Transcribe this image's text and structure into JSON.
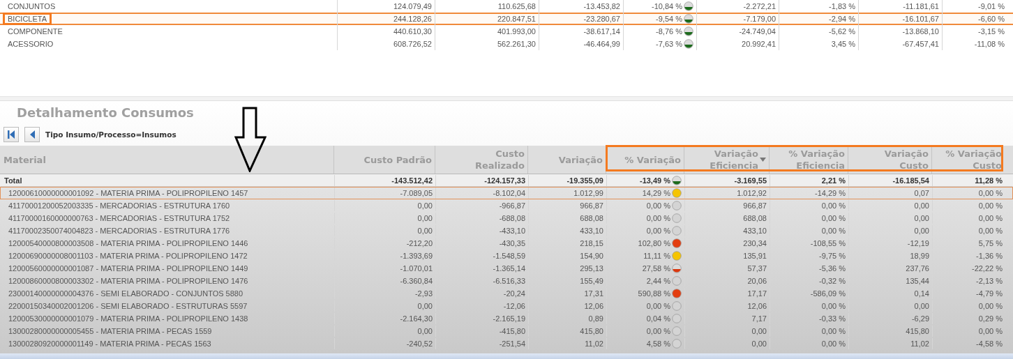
{
  "summary_table": {
    "rows": [
      {
        "name": "CONJUNTOS",
        "selected": false,
        "label_highlighted": false,
        "values": [
          "124.079,49",
          "110.625,68",
          "-13.453,82",
          "-10,84 %",
          "-2.272,21",
          "-1,83 %",
          "-11.181,61",
          "-9,01 %"
        ],
        "light": {
          "color": "#1d6b1d",
          "half": true
        }
      },
      {
        "name": "BICICLETA",
        "selected": true,
        "label_highlighted": true,
        "values": [
          "244.128,26",
          "220.847,51",
          "-23.280,67",
          "-9,54 %",
          "-7.179,00",
          "-2,94 %",
          "-16.101,67",
          "-6,60 %"
        ],
        "light": {
          "color": "#1d6b1d",
          "half": true
        }
      },
      {
        "name": "COMPONENTE",
        "selected": false,
        "label_highlighted": false,
        "values": [
          "440.610,30",
          "401.993,00",
          "-38.617,14",
          "-8,76 %",
          "-24.749,04",
          "-5,62 %",
          "-13.868,10",
          "-3,15 %"
        ],
        "light": {
          "color": "#1d6b1d",
          "half": true
        }
      },
      {
        "name": "ACESSORIO",
        "selected": false,
        "label_highlighted": false,
        "values": [
          "608.726,52",
          "562.261,30",
          "-46.464,99",
          "-7,63 %",
          "20.992,41",
          "3,45 %",
          "-67.457,41",
          "-11,08 %"
        ],
        "light": {
          "color": "#1d6b1d",
          "half": true
        }
      }
    ]
  },
  "detail": {
    "title": "Detalhamento Consumos",
    "filter": "Tipo Insumo/Processo=Insumos",
    "columns": [
      {
        "label": "Material",
        "sorted": false,
        "highlighted": false
      },
      {
        "label": "Custo Padrão",
        "sorted": false,
        "highlighted": false
      },
      {
        "label": "Custo\nRealizado",
        "sorted": false,
        "highlighted": false
      },
      {
        "label": "Variação",
        "sorted": false,
        "highlighted": false
      },
      {
        "label": "% Variação",
        "sorted": false,
        "highlighted": true
      },
      {
        "label": "Variação\nEficiencia",
        "sorted": true,
        "highlighted": true
      },
      {
        "label": "% Variação\nEficiencia",
        "sorted": false,
        "highlighted": true
      },
      {
        "label": "Variação\nCusto",
        "sorted": false,
        "highlighted": true
      },
      {
        "label": "% Variação\nCusto",
        "sorted": false,
        "highlighted": true
      }
    ],
    "total": {
      "name": "Total",
      "values": [
        "-143.512,42",
        "-124.157,33",
        "-19.355,09",
        "-13,49 %",
        "-3.169,55",
        "2,21 %",
        "-16.185,54",
        "11,28 %"
      ],
      "light": {
        "color": "#1d6b1d",
        "half": true
      }
    },
    "rows": [
      {
        "name": "12000610000000001092 - MATERIA PRIMA - POLIPROPILENO 1457",
        "selected": true,
        "values": [
          "-7.089,05",
          "-8.102,04",
          "1.012,99",
          "14,29 %",
          "1.012,92",
          "-14,29 %",
          "0,07",
          "0,00 %"
        ],
        "light": {
          "color": "#f5c400",
          "half": false
        }
      },
      {
        "name": "41170001200052003335 - MERCADORIAS - ESTRUTURA 1760",
        "selected": false,
        "values": [
          "0,00",
          "-966,87",
          "966,87",
          "0,00 %",
          "966,87",
          "0,00 %",
          "0,00",
          "0,00 %"
        ],
        "light": {
          "color": "#d4d4d4",
          "half": false
        }
      },
      {
        "name": "41170000160000000763 - MERCADORIAS - ESTRUTURA 1752",
        "selected": false,
        "values": [
          "0,00",
          "-688,08",
          "688,08",
          "0,00 %",
          "688,08",
          "0,00 %",
          "0,00",
          "0,00 %"
        ],
        "light": {
          "color": "#d4d4d4",
          "half": false
        }
      },
      {
        "name": "41170002350074004823 - MERCADORIAS - ESTRUTURA 1776",
        "selected": false,
        "values": [
          "0,00",
          "-433,10",
          "433,10",
          "0,00 %",
          "433,10",
          "0,00 %",
          "0,00",
          "0,00 %"
        ],
        "light": {
          "color": "#d4d4d4",
          "half": false
        }
      },
      {
        "name": "12000540000800003508 - MATERIA PRIMA - POLIPROPILENO 1446",
        "selected": false,
        "values": [
          "-212,20",
          "-430,35",
          "218,15",
          "102,80 %",
          "230,34",
          "-108,55 %",
          "-12,19",
          "5,75 %"
        ],
        "light": {
          "color": "#e33d10",
          "half": false
        }
      },
      {
        "name": "12000690000008001103 - MATERIA PRIMA - POLIPROPILENO 1472",
        "selected": false,
        "values": [
          "-1.393,69",
          "-1.548,59",
          "154,90",
          "11,11 %",
          "135,91",
          "-9,75 %",
          "18,99",
          "-1,36 %"
        ],
        "light": {
          "color": "#f5c400",
          "half": false
        }
      },
      {
        "name": "12000560000000001087 - MATERIA PRIMA - POLIPROPILENO 1449",
        "selected": false,
        "values": [
          "-1.070,01",
          "-1.365,14",
          "295,13",
          "27,58 %",
          "57,37",
          "-5,36 %",
          "237,76",
          "-22,22 %"
        ],
        "light": {
          "color": "#d9380f",
          "half": true
        }
      },
      {
        "name": "12000860000800003302 - MATERIA PRIMA - POLIPROPILENO 1476",
        "selected": false,
        "values": [
          "-6.360,84",
          "-6.516,33",
          "155,49",
          "2,44 %",
          "20,06",
          "-0,32 %",
          "135,44",
          "-2,13 %"
        ],
        "light": {
          "color": "#d4d4d4",
          "half": false
        }
      },
      {
        "name": "23000140000000004376 - SEMI ELABORADO - CONJUNTOS 5880",
        "selected": false,
        "values": [
          "-2,93",
          "-20,24",
          "17,31",
          "590,88 %",
          "17,17",
          "-586,09 %",
          "0,14",
          "-4,79 %"
        ],
        "light": {
          "color": "#e33d10",
          "half": false
        }
      },
      {
        "name": "22000150340002001206 - SEMI ELABORADO - ESTRUTURAS 5597",
        "selected": false,
        "values": [
          "0,00",
          "-12,06",
          "12,06",
          "0,00 %",
          "12,06",
          "0,00 %",
          "0,00",
          "0,00 %"
        ],
        "light": {
          "color": "#d4d4d4",
          "half": false
        }
      },
      {
        "name": "12000530000000001079 - MATERIA PRIMA - POLIPROPILENO 1438",
        "selected": false,
        "values": [
          "-2.164,30",
          "-2.165,19",
          "0,89",
          "0,04 %",
          "7,17",
          "-0,33 %",
          "-6,29",
          "0,29 %"
        ],
        "light": {
          "color": "#d4d4d4",
          "half": false
        }
      },
      {
        "name": "13000280000000005455 - MATERIA PRIMA - PECAS 1559",
        "selected": false,
        "values": [
          "0,00",
          "-415,80",
          "415,80",
          "0,00 %",
          "0,00",
          "0,00 %",
          "415,80",
          "0,00 %"
        ],
        "light": {
          "color": "#d4d4d4",
          "half": false
        }
      },
      {
        "name": "13000280920000001149 - MATERIA PRIMA - PECAS 1563",
        "selected": false,
        "values": [
          "-240,52",
          "-251,54",
          "11,02",
          "4,58 %",
          "0,00",
          "0,00 %",
          "11,02",
          "-4,58 %"
        ],
        "light": {
          "color": "#d4d4d4",
          "half": false
        }
      }
    ]
  }
}
